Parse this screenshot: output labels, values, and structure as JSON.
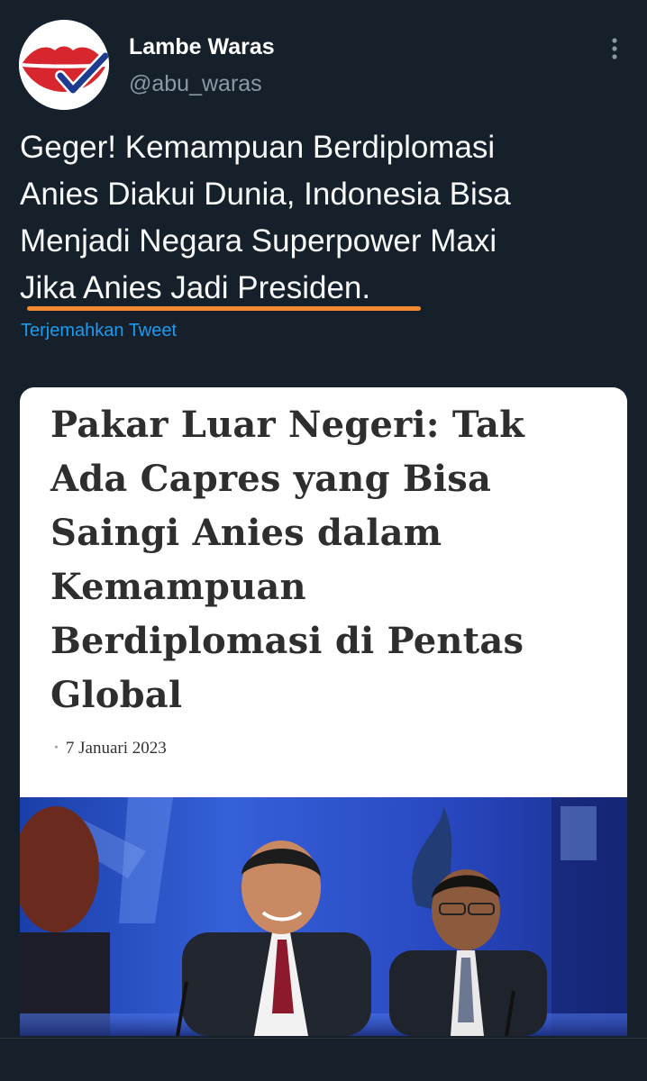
{
  "tweet": {
    "display_name": "Lambe Waras",
    "handle": "@abu_waras",
    "text": "Geger! Kemampuan Berdiplomasi\nAnies Diakui Dunia, Indonesia Bisa\nMenjadi Negara Superpower Maxi\nJika Anies Jadi Presiden.",
    "translate_label": "Terjemahkan Tweet",
    "more_icon": "more-vertical-icon",
    "avatar_icon": "lips-check-logo"
  },
  "card": {
    "headline": "Pakar Luar Negeri: Tak\nAda Capres yang Bisa\nSaingi Anies dalam\nKemampuan\nBerdiplomasi di Pentas\nGlobal",
    "date": "7 Januari 2023"
  },
  "colors": {
    "background": "#15202b",
    "accent": "#1d9bf0",
    "highlight_underline": "#f28a30",
    "card_background": "#ffffff"
  }
}
